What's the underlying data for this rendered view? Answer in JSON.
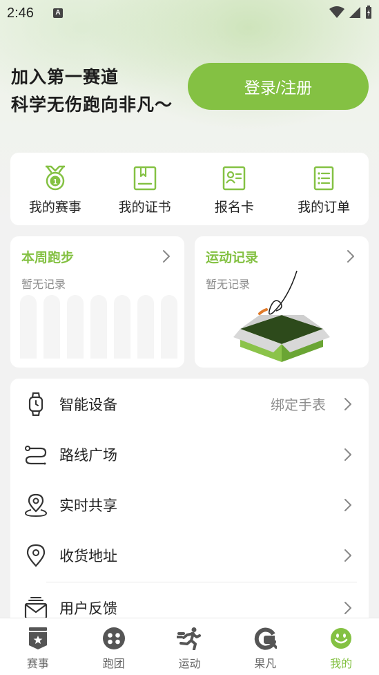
{
  "status_bar": {
    "time": "2:46",
    "notification_glyph": "A"
  },
  "hero": {
    "line1": "加入第一赛道",
    "line2": "科学无伤跑向非凡～",
    "login_label": "登录/注册"
  },
  "quick_actions": [
    {
      "label": "我的赛事",
      "icon": "medal-icon"
    },
    {
      "label": "我的证书",
      "icon": "certificate-icon"
    },
    {
      "label": "报名卡",
      "icon": "id-card-icon"
    },
    {
      "label": "我的订单",
      "icon": "order-list-icon"
    }
  ],
  "weekly_run": {
    "title": "本周跑步",
    "empty_text": "暂无记录",
    "bar_count": 7
  },
  "activity_record": {
    "title": "运动记录",
    "empty_text": "暂无记录"
  },
  "menu": [
    {
      "label": "智能设备",
      "value": "绑定手表",
      "icon": "watch-icon"
    },
    {
      "label": "路线广场",
      "value": "",
      "icon": "route-icon"
    },
    {
      "label": "实时共享",
      "value": "",
      "icon": "location-share-icon"
    },
    {
      "label": "收货地址",
      "value": "",
      "icon": "map-pin-icon"
    },
    {
      "label": "用户反馈",
      "value": "",
      "icon": "feedback-mail-icon"
    }
  ],
  "tabs": [
    {
      "label": "赛事",
      "icon": "event-badge-icon",
      "active": false
    },
    {
      "label": "跑团",
      "icon": "group-icon",
      "active": false
    },
    {
      "label": "运动",
      "icon": "runner-icon",
      "active": false
    },
    {
      "label": "果凡",
      "icon": "brand-g-icon",
      "active": false
    },
    {
      "label": "我的",
      "icon": "smile-icon",
      "active": true
    }
  ],
  "colors": {
    "accent": "#84c143",
    "muted_text": "#8d8d8d",
    "icon_dark": "#333333"
  }
}
